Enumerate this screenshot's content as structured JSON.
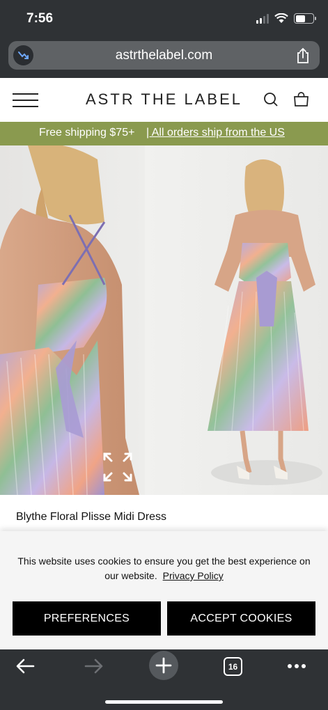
{
  "status_bar": {
    "time": "7:56"
  },
  "browser": {
    "url": "astrthelabel.com",
    "tab_count": "16",
    "icons": [
      "back-icon",
      "forward-icon",
      "new-tab-icon",
      "tabs-icon",
      "more-icon",
      "share-icon"
    ]
  },
  "site": {
    "brand": "ASTR THE LABEL",
    "promo_left": "Free shipping $75+",
    "promo_right": "| All orders ship from the US",
    "promo_color": "#8a9a4f"
  },
  "product": {
    "title": "Blythe Floral Plisse Midi Dress"
  },
  "cookie": {
    "message": "This website uses cookies to ensure you get the best experience on our website.",
    "policy_link": "Privacy Policy",
    "preferences_label": "PREFERENCES",
    "accept_label": "ACCEPT COOKIES"
  }
}
